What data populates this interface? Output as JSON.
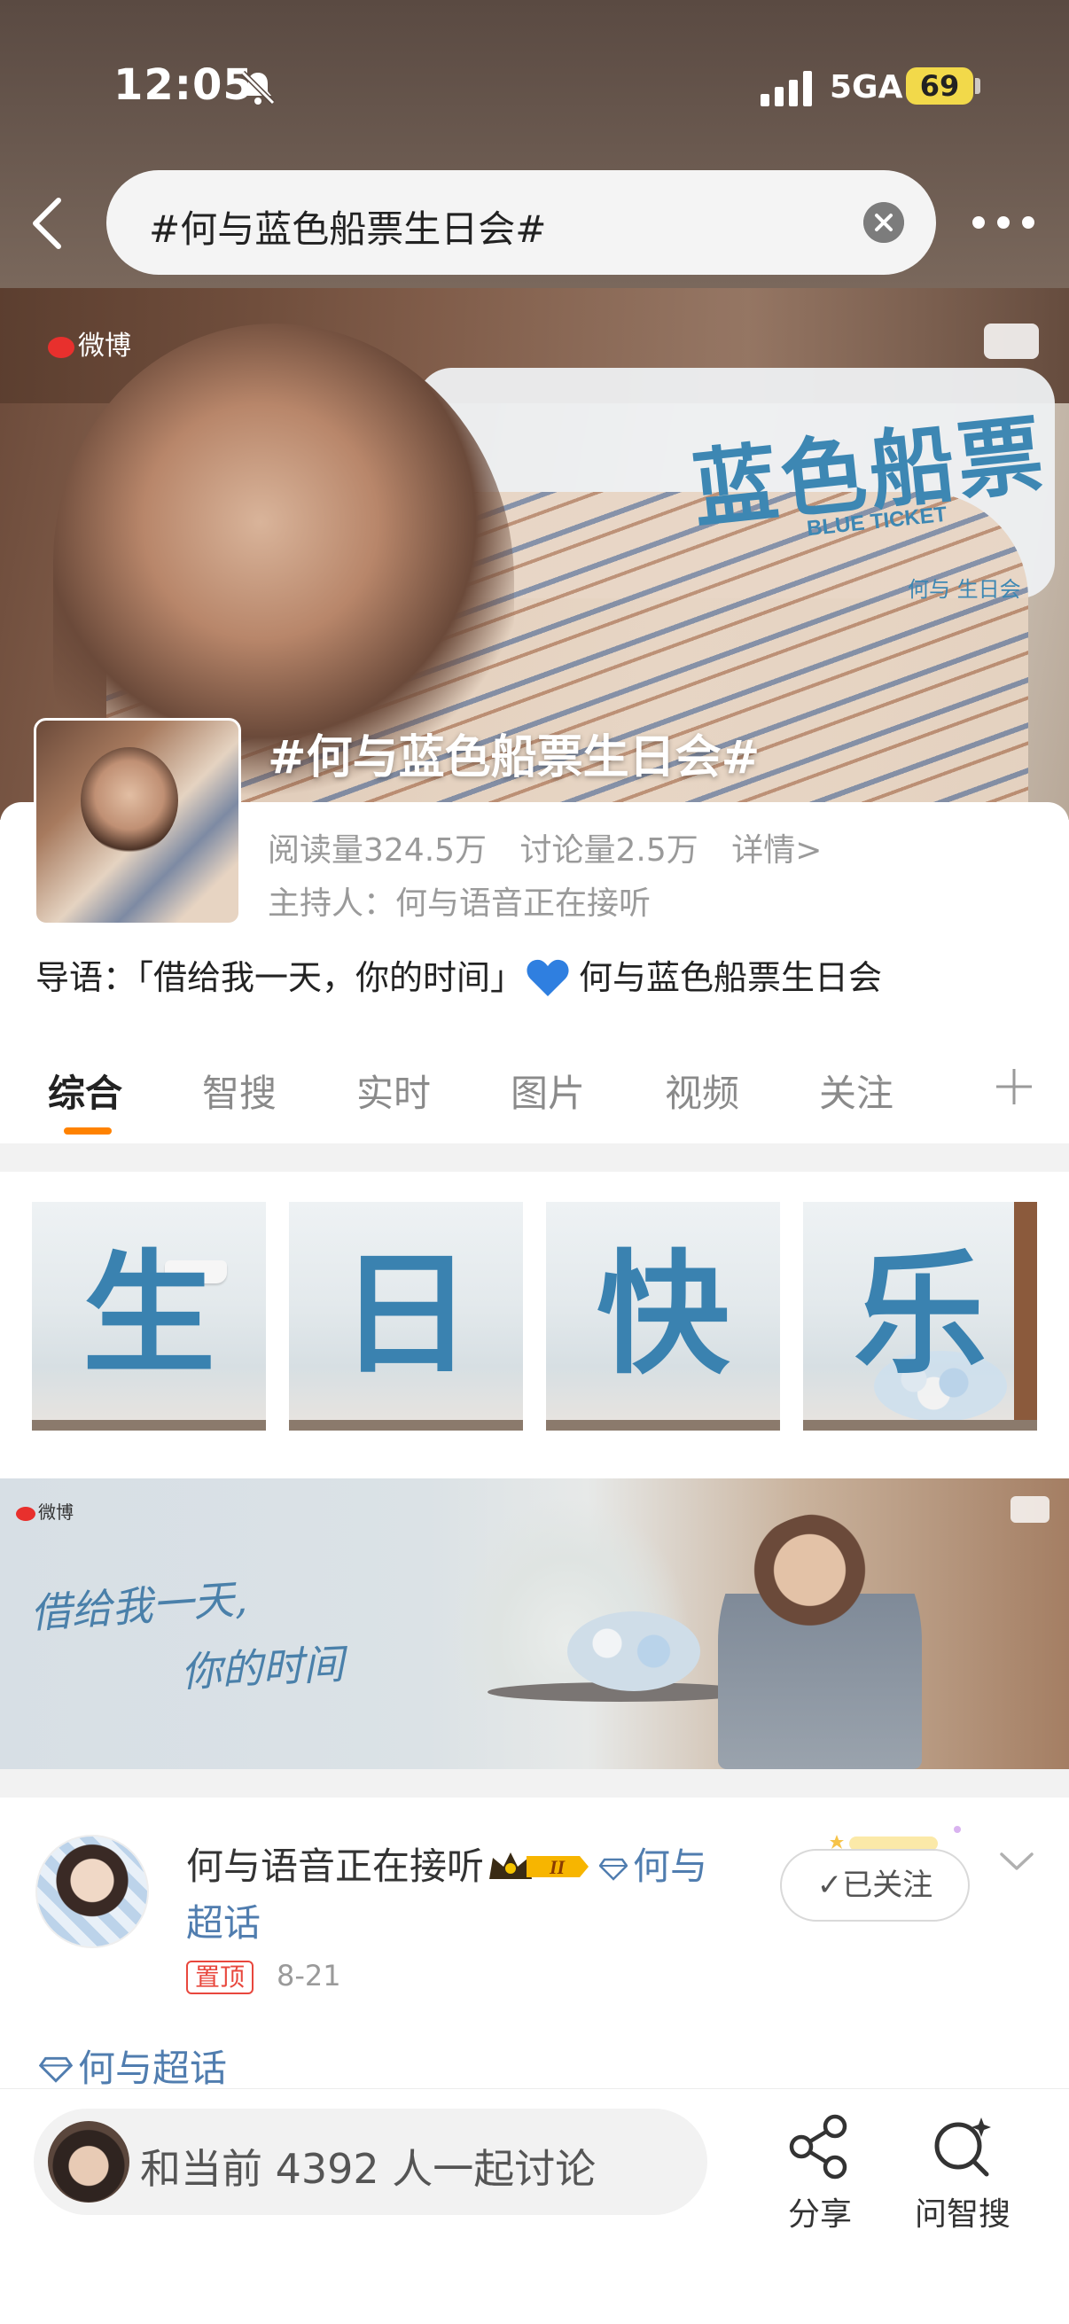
{
  "status_bar": {
    "time": "12:05",
    "network": "5GA",
    "battery": "69"
  },
  "search": {
    "query": "#何与蓝色船票生日会#"
  },
  "banner": {
    "brand": "微博",
    "title": "蓝色船票",
    "subtitle": "BLUE TICKET",
    "host_line": "何与 生日会"
  },
  "topic": {
    "title": "#何与蓝色船票生日会#",
    "reads": "阅读量324.5万",
    "discussions": "讨论量2.5万",
    "details_link": "详情>",
    "host": "主持人：何与语音正在接听",
    "intro_before": "导语：「借给我一天，你的时间」",
    "intro_after": "何与蓝色船票生日会"
  },
  "tabs": [
    {
      "label": "综合",
      "active": true
    },
    {
      "label": "智搜",
      "active": false
    },
    {
      "label": "实时",
      "active": false
    },
    {
      "label": "图片",
      "active": false
    },
    {
      "label": "视频",
      "active": false
    },
    {
      "label": "关注",
      "active": false
    }
  ],
  "tiles": [
    "生",
    "日",
    "快",
    "乐"
  ],
  "promo": {
    "brand": "微博",
    "line1": "借给我一天,",
    "line2": "你的时间"
  },
  "post": {
    "author": "何与语音正在接听",
    "rank_badge": "II",
    "supertopic_inline": "何与超话",
    "pinned": "置顶",
    "date": "8-21",
    "follow_label": "已关注",
    "supertopic_link": "何与超话"
  },
  "bottom_bar": {
    "discuss_text": "和当前 4392 人一起讨论",
    "share_label": "分享",
    "ai_search_label": "问智搜"
  },
  "colors": {
    "accent_orange": "#ff8200",
    "link_blue": "#507daf",
    "ticket_blue": "#3d87b3",
    "pinned_red": "#e8473d"
  }
}
